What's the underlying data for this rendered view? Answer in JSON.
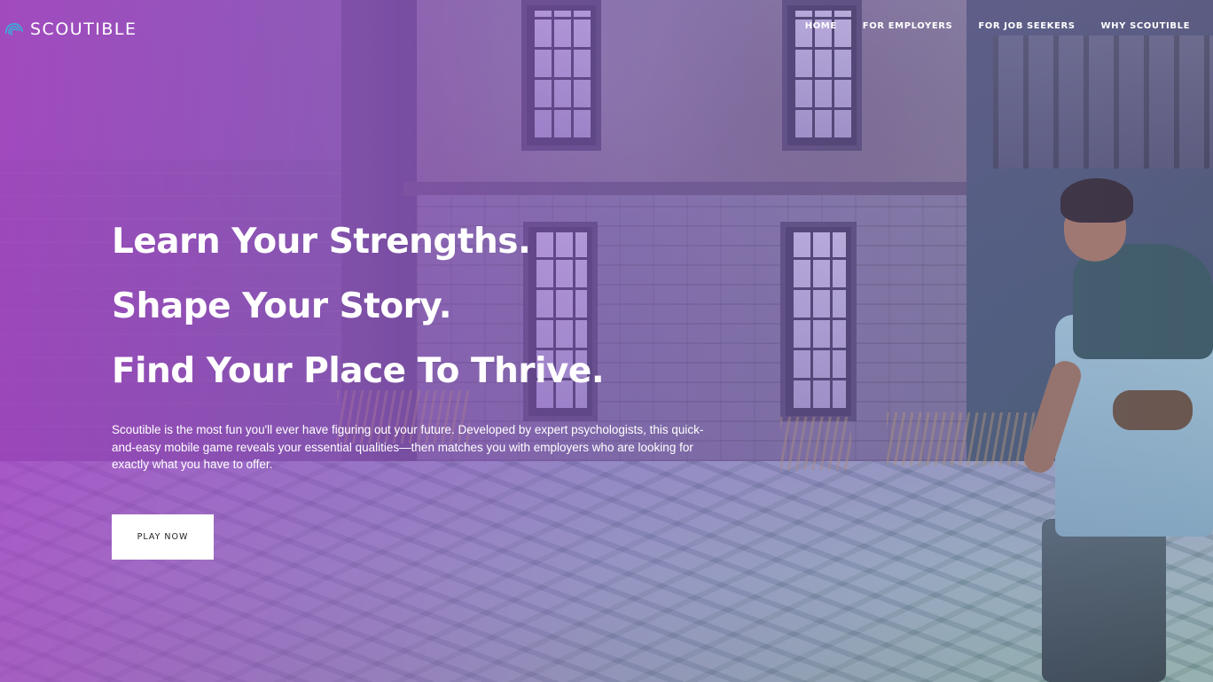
{
  "header": {
    "logo_text": "SCOUTIBLE",
    "logo_icon": "fingerprint-icon",
    "nav": [
      {
        "label": "HOME"
      },
      {
        "label": "FOR EMPLOYERS"
      },
      {
        "label": "FOR JOB SEEKERS"
      },
      {
        "label": "WHY SCOUTIBLE"
      }
    ]
  },
  "hero": {
    "headlines": [
      "Learn Your Strengths.",
      "Shape Your Story.",
      "Find Your Place To Thrive."
    ],
    "description": "Scoutible is the most fun you'll ever have figuring out your future. Developed by expert psychologists, this quick-and-easy mobile game reveals your essential qualities—then matches you with employers who are looking for exactly what you have to offer.",
    "cta_label": "PLAY NOW"
  },
  "colors": {
    "overlay_purple": "#aa3cc8",
    "text": "#ffffff",
    "logo_accent": "#3fa9d6",
    "button_bg": "#ffffff",
    "button_text": "#222222"
  }
}
